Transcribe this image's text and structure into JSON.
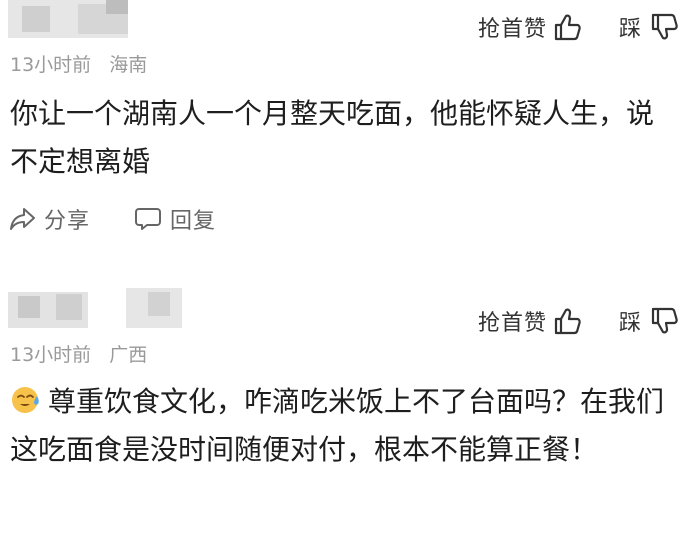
{
  "comments": [
    {
      "like_label": "抢首赞",
      "dislike_label": "踩",
      "time": "13小时前",
      "location": "海南",
      "text": "你让一个湖南人一个月整天吃面，他能怀疑人生，说不定想离婚",
      "share_label": "分享",
      "reply_label": "回复"
    },
    {
      "like_label": "抢首赞",
      "dislike_label": "踩",
      "time": "13小时前",
      "location": "广西",
      "emoji": "sweat-smile-emoji",
      "text": "尊重饮食文化，咋滴吃米饭上不了台面吗？在我们这吃面食是没时间随便对付，根本不能算正餐！"
    }
  ],
  "colors": {
    "text": "#1e1e1e",
    "meta": "#9a9a9a",
    "action": "#333333",
    "emoji_face": "#f7c24a",
    "emoji_sweat": "#5aa9e6"
  }
}
